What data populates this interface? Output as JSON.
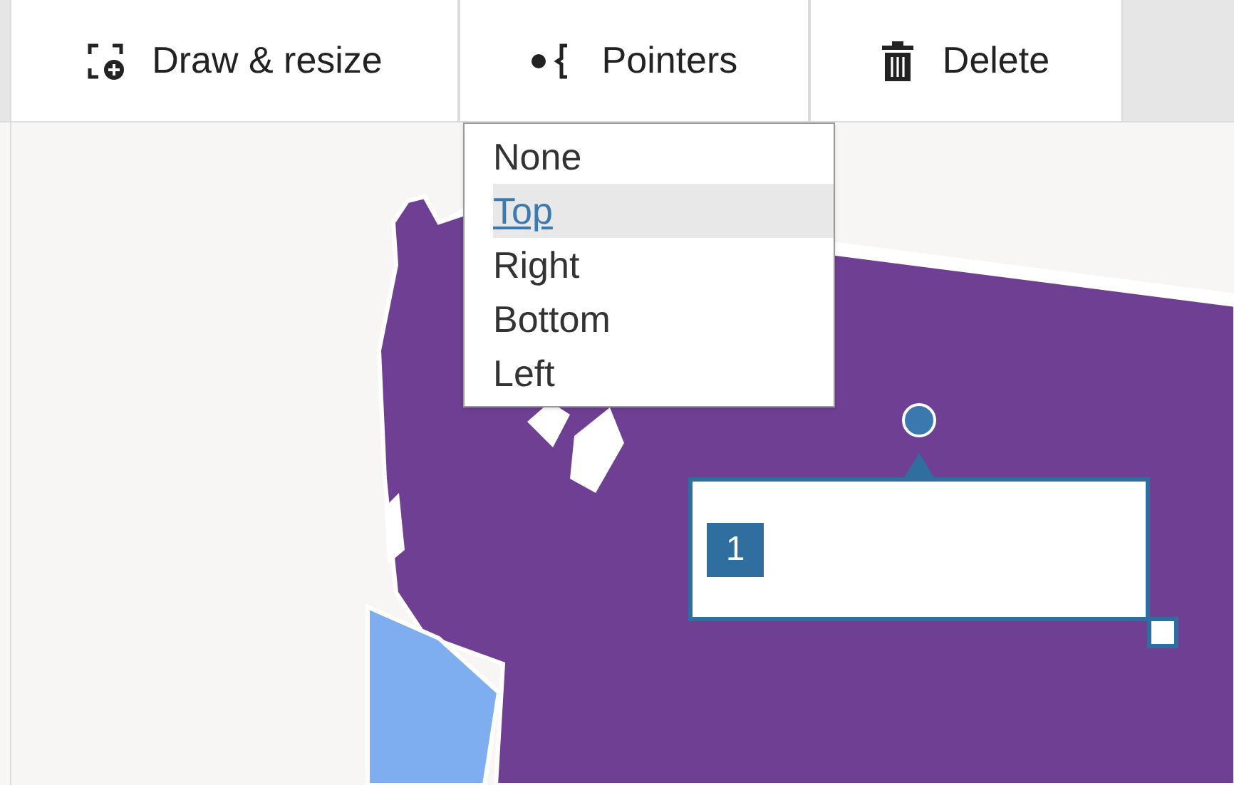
{
  "toolbar": {
    "buttons": [
      {
        "label": "Draw & resize",
        "kind": "draw"
      },
      {
        "label": "Pointers",
        "kind": "pointers"
      },
      {
        "label": "Delete",
        "kind": "delete"
      }
    ]
  },
  "pointer_menu": {
    "items": [
      {
        "label": "None",
        "selected": false
      },
      {
        "label": "Top",
        "selected": true
      },
      {
        "label": "Right",
        "selected": false
      },
      {
        "label": "Bottom",
        "selected": false
      },
      {
        "label": "Left",
        "selected": false
      }
    ]
  },
  "annotation": {
    "number": "1"
  }
}
